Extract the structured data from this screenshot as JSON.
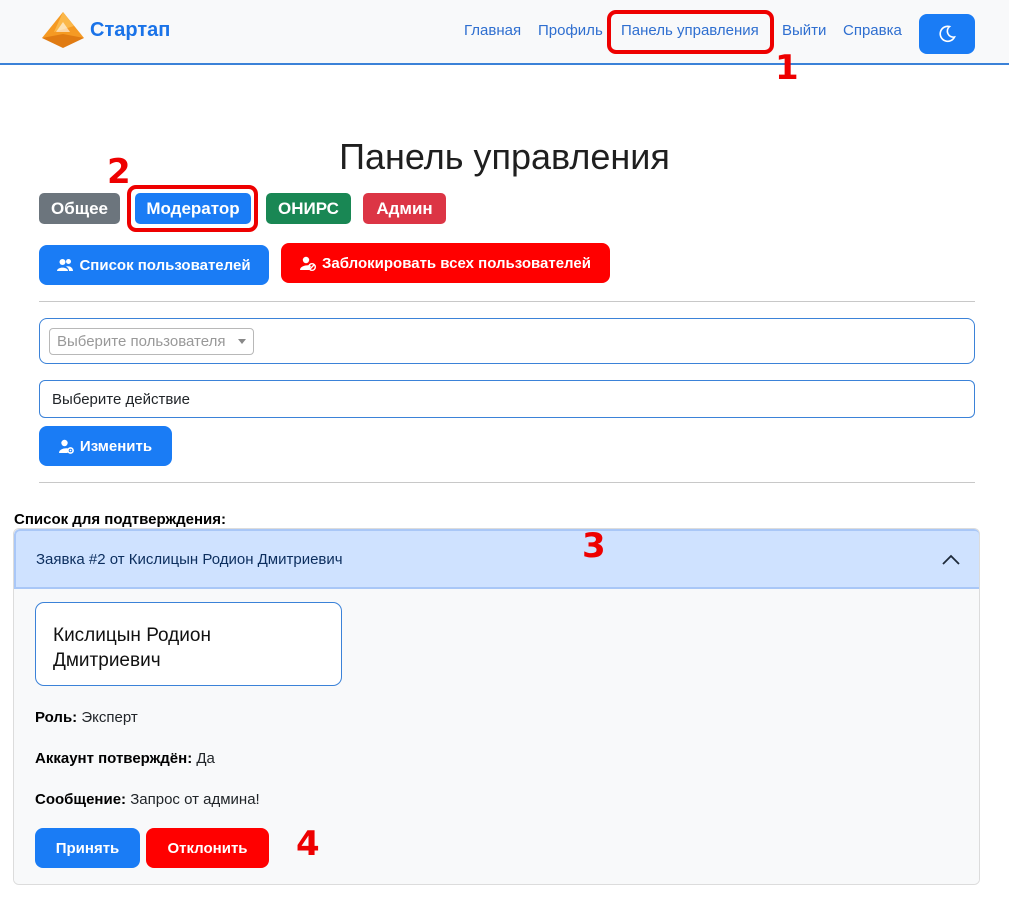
{
  "navbar": {
    "brand": "Стартап",
    "links": [
      "Главная",
      "Профиль",
      "Панель управления",
      "Выйти",
      "Справка"
    ]
  },
  "annotations": [
    "1",
    "2",
    "3",
    "4"
  ],
  "page": {
    "title": "Панель управления"
  },
  "roles": [
    "Общее",
    "Модератор",
    "ОНИРС",
    "Админ"
  ],
  "actions": {
    "user_list": "Список пользователей",
    "block_all": "Заблокировать всех пользователей",
    "change": "Изменить"
  },
  "form": {
    "user_placeholder": "Выберите пользователя",
    "action_value": "Выберите действие"
  },
  "confirm_list": {
    "label": "Список для подтверждения:",
    "item": {
      "title": "Заявка #2 от Кислицын Родион Дмитриевич",
      "name_line1": "Кислицын Родион",
      "name_line2": "Дмитриевич",
      "role_label": "Роль:",
      "role_value": "Эксперт",
      "confirmed_label": "Аккаунт потверждён:",
      "confirmed_value": "Да",
      "message_label": "Сообщение:",
      "message_value": "Запрос от админа!",
      "accept": "Принять",
      "reject": "Отклонить"
    }
  },
  "colors": {
    "primary": "#1a7cf5",
    "danger": "#ff0000",
    "secondary": "#6c757d",
    "success": "#198754",
    "admin": "#dc3545",
    "annotation": "#ee0000"
  }
}
